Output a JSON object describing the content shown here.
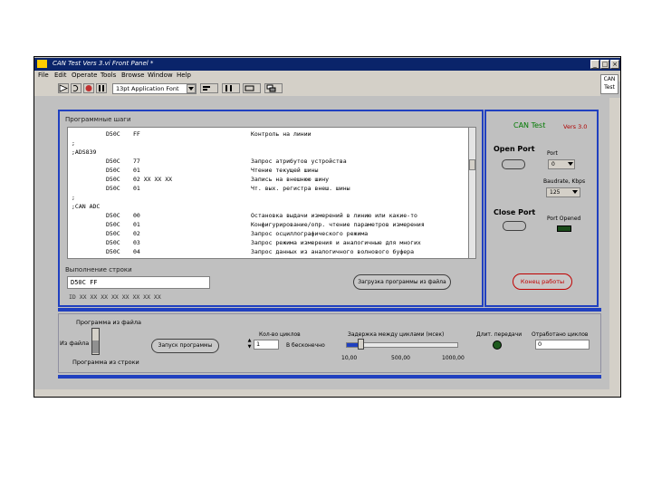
{
  "window": {
    "title": "CAN Test Vers 3.vi Front Panel *",
    "controls": [
      "_",
      "□",
      "×"
    ]
  },
  "menubar": [
    "File",
    "Edit",
    "Operate",
    "Tools",
    "Browse",
    "Window",
    "Help"
  ],
  "toolbar": {
    "font_select": "13pt Application Font",
    "panel_icon_text": "CAN Test"
  },
  "program": {
    "label": "Программные шаги",
    "rows": [
      [
        "",
        "D50C",
        "FF",
        "Контроль на линии"
      ],
      [
        ";",
        "",
        "",
        ""
      ],
      [
        ";ADS839",
        "",
        "",
        ""
      ],
      [
        "",
        "D50C",
        "77",
        "Запрос атрибутов устройства"
      ],
      [
        "",
        "D50C",
        "01",
        "Чтение текущей шины"
      ],
      [
        "",
        "D50C",
        "02 XX XX XX",
        "Запись на внешнюю шину"
      ],
      [
        "",
        "D50C",
        "01",
        "Чт. вых. регистра внеш. шины"
      ],
      [
        ";",
        "",
        "",
        ""
      ],
      [
        ";CAN ADC",
        "",
        "",
        ""
      ],
      [
        "",
        "D50C",
        "00",
        "Остановка выдачи измерений в линию или какие-то"
      ],
      [
        "",
        "D50C",
        "01",
        "Конфигурирование/опр. чтение параметров измерения"
      ],
      [
        "",
        "D50C",
        "02",
        "Запрос осциллографического режима"
      ],
      [
        "",
        "D50C",
        "03",
        "Запрос режима измерения и аналогичные для многих"
      ],
      [
        "",
        "D50C",
        "04",
        "Запрос данных из аналогичного волнового буфера"
      ]
    ],
    "string_label": "Выполнение строки",
    "string_value": "D50C  FF",
    "format_hint": "ID    XX XX XX XX XX XX XX XX",
    "load_button": "Загрузка программы из файла"
  },
  "port": {
    "title": "CAN Test",
    "version": "Vers 3.0",
    "open_label": "Open Port",
    "port_label": "Port",
    "port_value": "0",
    "baud_label": "Baudrate, Kbps",
    "baud_value": "125",
    "close_label": "Close Port",
    "opened_label": "Port Opened",
    "stop_button": "Конец работы"
  },
  "bottom": {
    "source_label": "Программа из файла",
    "source_file": "Из файла",
    "source_string": "Программа из строки",
    "run_button": "Запуск программы",
    "count_label": "Кол-во циклов",
    "count_value": "1",
    "infinite_label": "В бесконечно",
    "delay_label": "Задержка между циклами (мсек)",
    "delay_ticks": [
      "10,00",
      "500,00",
      "1000,00"
    ],
    "long_label": "Длит. передачи",
    "sent_label": "Отработано циклов",
    "sent_value": "0"
  },
  "colors": {
    "title_bar": "#0a246a",
    "frame_blue": "#2040c0",
    "panel_gray": "#c0c0c0",
    "accent_green": "#007a00",
    "accent_red": "#c00000"
  }
}
